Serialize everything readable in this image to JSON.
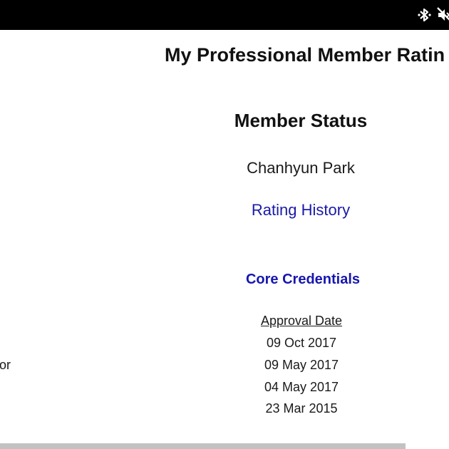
{
  "status_bar": {
    "icons": [
      "bluetooth-icon",
      "volume-muted-icon"
    ],
    "background": "#000000"
  },
  "page": {
    "title": "My Professional Member Ratin",
    "member_status_heading": "Member Status",
    "member_name": "Chanhyun Park",
    "rating_history_link": "Rating History",
    "core_credentials_heading": "Core Credentials",
    "table": {
      "left_column_fragment": "or",
      "approval_date_header": "Approval Date",
      "approval_dates": [
        "09 Oct 2017",
        "09 May 2017",
        "04 May 2017",
        "23 Mar 2015"
      ]
    }
  },
  "colors": {
    "link": "#1a1aa6",
    "heading_link": "#1616b0",
    "scrollbar": "#c2c2c2"
  }
}
